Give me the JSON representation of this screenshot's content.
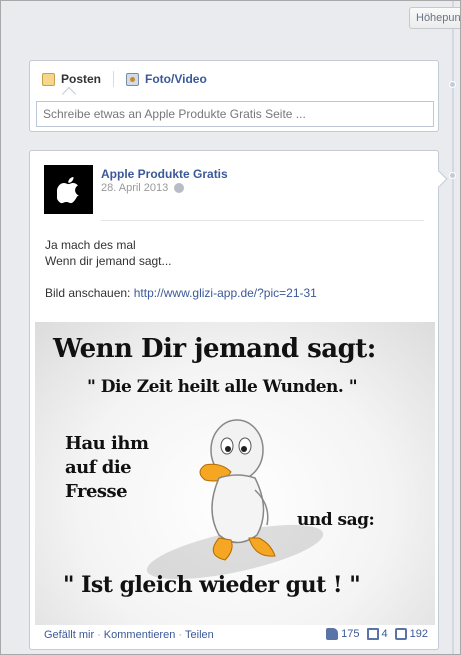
{
  "header": {
    "hoehepunkte_label": "Höhepunk"
  },
  "composer": {
    "tabs": [
      {
        "label": "Posten",
        "icon": "status-icon"
      },
      {
        "label": "Foto/Video",
        "icon": "photo-icon"
      }
    ],
    "input_placeholder": "Schreibe etwas an Apple Produkte Gratis Seite ..."
  },
  "post": {
    "author": "Apple Produkte Gratis",
    "avatar_icon": "apple-logo",
    "date": "28. April 2013",
    "privacy_icon": "globe-icon",
    "text_lines": [
      "Ja mach des mal",
      "Wenn dir jemand sagt...",
      "",
      "Bild anschauen: "
    ],
    "link": "http://www.glizi-app.de/?pic=21-31",
    "image": {
      "line1": "Wenn Dir jemand sagt:",
      "line2": "\" Die Zeit heilt alle Wunden. \"",
      "line3": "Hau ihm\nauf die\nFresse",
      "line4": "und sag:",
      "line5": "\" Ist gleich wieder gut ! \""
    },
    "actions": {
      "like": "Gefällt mir",
      "comment": "Kommentieren",
      "share": "Teilen"
    },
    "counts": {
      "likes": "175",
      "comments": "4",
      "shares": "192"
    }
  },
  "colors": {
    "link": "#3b5998",
    "background": "#e9ebee"
  }
}
